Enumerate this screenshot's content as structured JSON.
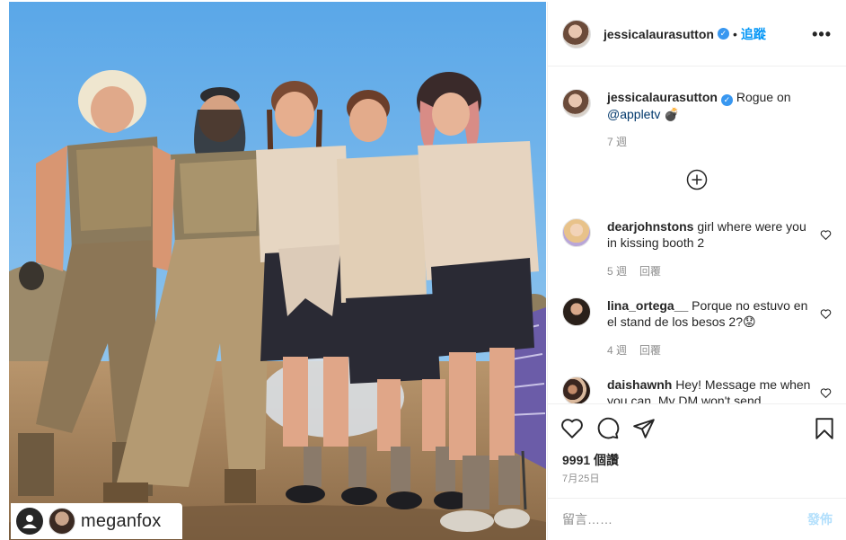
{
  "post": {
    "header": {
      "username": "jessicalaurasutton",
      "verified": true,
      "separator": "•",
      "follow_label": "追蹤",
      "more_label": "•••"
    },
    "caption": {
      "username": "jessicalaurasutton",
      "text": "Rogue on",
      "mention": "@appletv",
      "emoji": "💣",
      "time": "7 週"
    },
    "comments": [
      {
        "username": "dearjohnstons",
        "text": "girl where were you in kissing booth 2",
        "time": "5 週",
        "reply_label": "回覆"
      },
      {
        "username": "lina_ortega__",
        "text": "Porque no estuvo en el stand de los besos 2?",
        "emoji": "😟",
        "time": "4 週",
        "reply_label": "回覆"
      },
      {
        "username": "daishawnh",
        "text": "Hey! Message me when you can. My DM won't send"
      }
    ],
    "likes": "9991 個讚",
    "date": "7月25日",
    "comment_placeholder": "留言……",
    "post_label": "發佈",
    "photo_tag": "meganfox"
  },
  "colors": {
    "accent": "#0095f6",
    "verified": "#3897f0",
    "muted": "#8e8e8e",
    "sky": "#7ab6e6",
    "ground": "#a88763"
  },
  "icons": [
    "verified-icon",
    "more-icon",
    "add-circle-icon",
    "heart-icon",
    "comment-icon",
    "share-icon",
    "bookmark-icon",
    "user-tag-icon"
  ]
}
